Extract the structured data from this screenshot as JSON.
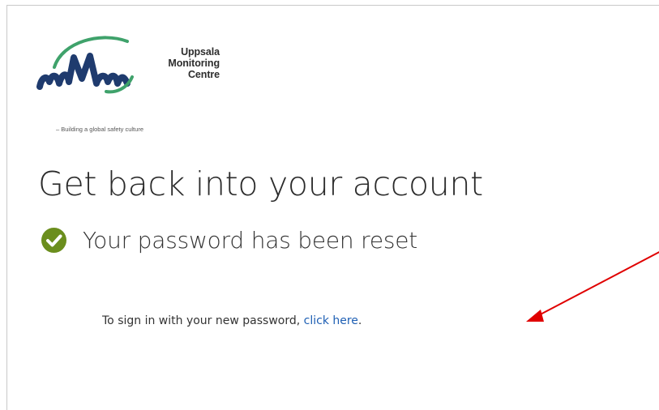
{
  "logo": {
    "line1": "Uppsala",
    "line2": "Monitoring",
    "line3": "Centre",
    "tagline": "– Building a global safety culture"
  },
  "page": {
    "title": "Get back into your account",
    "status_message": "Your password has been reset",
    "instruction_prefix": "To sign in with your new password, ",
    "link_text": "click here",
    "instruction_suffix": "."
  },
  "colors": {
    "brand_navy": "#1f3b6e",
    "brand_green": "#3fa26b",
    "check_green": "#6b8e1d",
    "link_blue": "#1e5fb4",
    "annotation_red": "#e00000"
  },
  "icons": {
    "status": "check-circle-icon",
    "annotation": "red-arrow-icon"
  }
}
